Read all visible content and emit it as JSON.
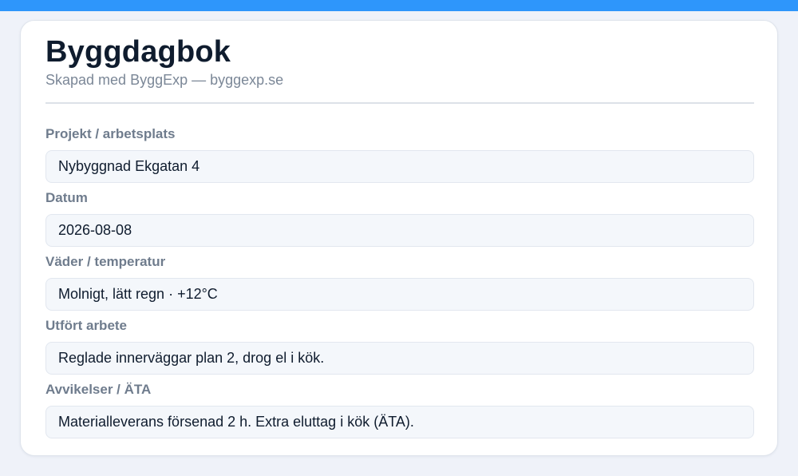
{
  "header": {
    "title": "Byggdagbok",
    "subtitle": "Skapad med ByggExp — byggexp.se"
  },
  "fields": [
    {
      "label": "Projekt / arbetsplats",
      "value": "Nybyggnad Ekgatan 4"
    },
    {
      "label": "Datum",
      "value": "2026-08-08"
    },
    {
      "label": "Väder / temperatur",
      "value": "Molnigt, lätt regn · +12°C"
    },
    {
      "label": "Utfört arbete",
      "value": "Reglade innerväggar plan 2, drog el i kök."
    },
    {
      "label": "Avvikelser / ÄTA",
      "value": "Materialleverans försenad 2 h. Extra eluttag i kök (ÄTA)."
    }
  ],
  "colors": {
    "accent": "#2e96fb",
    "background": "#eff2f9",
    "card": "#ffffff",
    "title": "#0f1c2e",
    "label": "#6f7c8d"
  }
}
